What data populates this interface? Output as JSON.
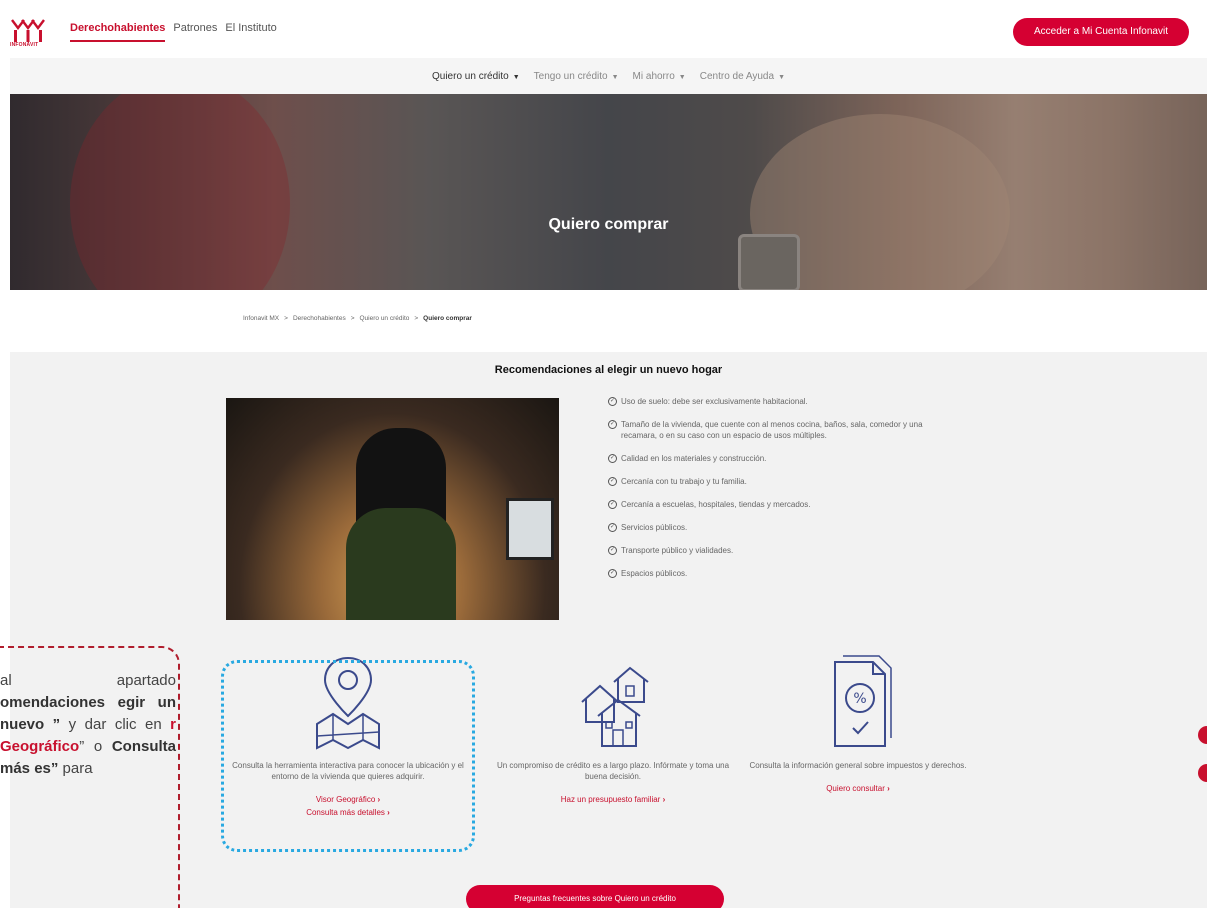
{
  "header": {
    "logo_text": "INFONAVIT",
    "tabs": [
      {
        "label": "Derechohabientes",
        "active": true
      },
      {
        "label": "Patrones",
        "active": false
      },
      {
        "label": "El Instituto",
        "active": false
      }
    ],
    "account_button": "Acceder a Mi Cuenta Infonavit"
  },
  "subnav": {
    "items": [
      {
        "label": "Quiero un crédito",
        "active": true
      },
      {
        "label": "Tengo un crédito",
        "active": false
      },
      {
        "label": "Mi ahorro",
        "active": false
      },
      {
        "label": "Centro de Ayuda",
        "active": false
      }
    ]
  },
  "hero": {
    "title": "Quiero comprar"
  },
  "breadcrumb": {
    "items": [
      "Infonavit MX",
      "Derechohabientes",
      "Quiero un crédito",
      "Quiero comprar"
    ],
    "separator": ">"
  },
  "recommendations": {
    "title": "Recomendaciones al elegir un nuevo hogar",
    "items": [
      "Uso de suelo: debe ser exclusivamente habitacional.",
      "Tamaño de la vivienda, que cuente con al menos cocina, baños, sala, comedor y una recamara, o en su caso con un espacio de usos múltiples.",
      "Calidad en los materiales y construcción.",
      "Cercanía con tu trabajo y tu familia.",
      "Cercanía a escuelas, hospitales, tiendas y mercados.",
      "Servicios públicos.",
      "Transporte público y vialidades.",
      "Espacios públicos."
    ]
  },
  "cards": [
    {
      "icon": "map-location-icon",
      "description": "Consulta la herramienta interactiva para conocer la ubicación y el entorno de la vivienda que quieres adquirir.",
      "links": [
        "Visor Geográfico",
        "Consulta más detalles"
      ]
    },
    {
      "icon": "houses-icon",
      "description": "Un compromiso de crédito es a largo plazo. Infórmate y toma una buena decisión.",
      "links": [
        "Haz un presupuesto familiar"
      ]
    },
    {
      "icon": "tax-document-icon",
      "description": "Consulta la información general sobre impuestos y derechos.",
      "links": [
        "Quiero consultar"
      ]
    }
  ],
  "faq_button": "Preguntas frecuentes sobre Quiero un crédito",
  "callout": {
    "parts": [
      {
        "text": "al apartado ",
        "style": "normal"
      },
      {
        "text": "omendaciones egir un nuevo ”",
        "style": "bold"
      },
      {
        "text": " y dar clic en ",
        "style": "normal"
      },
      {
        "text": "r Geográfico",
        "style": "red"
      },
      {
        "text": "” o ",
        "style": "normal"
      },
      {
        "text": "Consulta más es”",
        "style": "bold"
      },
      {
        "text": " para",
        "style": "normal"
      }
    ]
  },
  "colors": {
    "brand_red": "#c8102e",
    "button_red": "#d50032",
    "highlight_blue": "#29a9e1",
    "callout_border": "#b01e2e"
  }
}
